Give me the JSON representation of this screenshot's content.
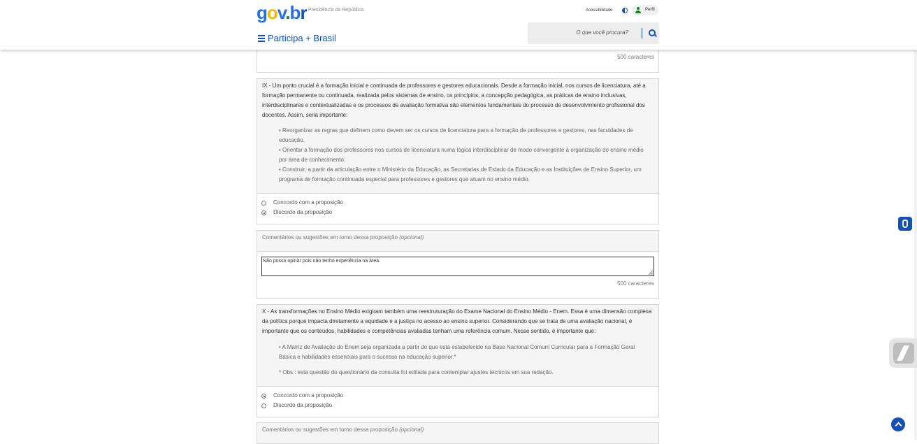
{
  "header": {
    "logo": {
      "g": "g",
      "o": "o",
      "v": "v",
      ".": ".",
      "b": "b",
      "r": "r"
    },
    "org": "Presidência da República",
    "accessibility": "Acessibilidade",
    "profile": "Perfil",
    "site_title": "Participa + Brasil",
    "search_placeholder": "O que você procura?"
  },
  "counter_text": "500 caracteres",
  "q9": {
    "text": "IX - Um ponto crucial é a formação inicial e continuada de professores e gestores educacionais. Desde a formação inicial, nos cursos de licenciatura, até a formação permanente ou continuada, realizada pelos sistemas de ensino, os princípios, a concepção pedagógica, as práticas de ensino inclusivas, interdisciplinares e contextualizadas e os processos de avaliação formativa são elementos fundamentais do processo de desenvolvimento profissional dos docentes. Assim, seria importante:",
    "bullets": [
      "• Reorganizar as regras que definem como devem ser os cursos de licenciatura para a formação de professores e gestores, nas faculdades de educação.",
      "• Orientar a formação dos professores nos cursos de licenciatura numa lógica interdisciplinar de modo convergente à organização do ensino médio por área de conhecimento.",
      "• Construir, a partir da articulação entre o Ministério da Educação, as Secretarias de Estado da Educação e as Instituições de Ensino Superior, um programa de formação continuada especial para professores e gestores que atuam no ensino médio."
    ],
    "options": [
      "Concordo com a proposição",
      "Discordo da proposição"
    ],
    "selected": 1
  },
  "comment9": {
    "label": "Comentários ou sugestões em torno dessa proposição",
    "optional": "(opcional)",
    "value": "Não posso opinar pois não tenho experiência na área."
  },
  "q10": {
    "text": "X - As transformações no Ensino Médio exigiram também uma reestruturação do Exame Nacional do Ensino Médio - Enem. Essa é uma dimensão complexa da política porque impacta diretamente a equidade e a justiça no acesso ao ensino superior. Considerando que se trata de uma avaliação nacional, é importante que os conteúdos, habilidades e competências avaliadas tenham uma referência comum. Nesse sentido, é importante que:",
    "bullets": [
      "• A Matriz de Avaliação do Enem seja organizada a partir do que está estabelecido na Base Nacional Comum Curricular para a Formação Geral Básica e habilidades essenciais para o sucesso na educação superior.*",
      "* Obs.: esta questão do questionário da consulta foi editada para contemplar ajustes técnicos em sua redação."
    ],
    "options": [
      "Concordo com a proposição",
      "Discordo da proposição"
    ],
    "selected": 0
  },
  "comment10": {
    "label": "Comentários ou sugestões em torno dessa proposição",
    "optional": "(opcional)"
  }
}
